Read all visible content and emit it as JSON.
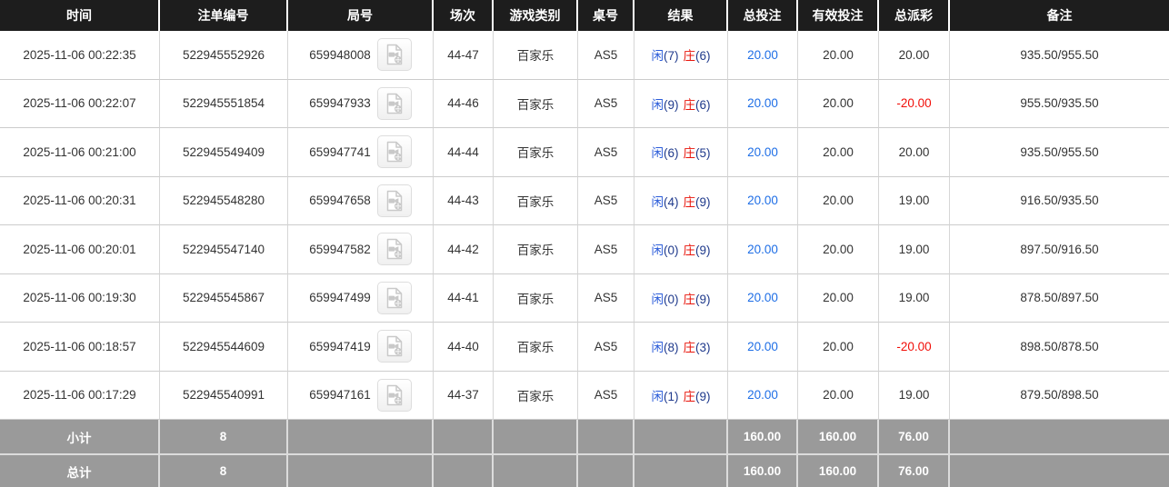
{
  "table": {
    "columns": [
      "时间",
      "注单编号",
      "局号",
      "场次",
      "游戏类别",
      "桌号",
      "结果",
      "总投注",
      "有效投注",
      "总派彩",
      "备注"
    ],
    "rows": [
      {
        "time": "2025-11-06 00:22:35",
        "bet_id": "522945552926",
        "round_id": "659948008",
        "session": "44-47",
        "game_type": "百家乐",
        "table_no": "AS5",
        "player": "闲",
        "player_score": "(7)",
        "banker": "庄",
        "banker_score": "(6)",
        "total_bet": "20.00",
        "valid_bet": "20.00",
        "payout": "20.00",
        "remark": "935.50/955.50"
      },
      {
        "time": "2025-11-06 00:22:07",
        "bet_id": "522945551854",
        "round_id": "659947933",
        "session": "44-46",
        "game_type": "百家乐",
        "table_no": "AS5",
        "player": "闲",
        "player_score": "(9)",
        "banker": "庄",
        "banker_score": "(6)",
        "total_bet": "20.00",
        "valid_bet": "20.00",
        "payout": "-20.00",
        "remark": "955.50/935.50"
      },
      {
        "time": "2025-11-06 00:21:00",
        "bet_id": "522945549409",
        "round_id": "659947741",
        "session": "44-44",
        "game_type": "百家乐",
        "table_no": "AS5",
        "player": "闲",
        "player_score": "(6)",
        "banker": "庄",
        "banker_score": "(5)",
        "total_bet": "20.00",
        "valid_bet": "20.00",
        "payout": "20.00",
        "remark": "935.50/955.50"
      },
      {
        "time": "2025-11-06 00:20:31",
        "bet_id": "522945548280",
        "round_id": "659947658",
        "session": "44-43",
        "game_type": "百家乐",
        "table_no": "AS5",
        "player": "闲",
        "player_score": "(4)",
        "banker": "庄",
        "banker_score": "(9)",
        "total_bet": "20.00",
        "valid_bet": "20.00",
        "payout": "19.00",
        "remark": "916.50/935.50"
      },
      {
        "time": "2025-11-06 00:20:01",
        "bet_id": "522945547140",
        "round_id": "659947582",
        "session": "44-42",
        "game_type": "百家乐",
        "table_no": "AS5",
        "player": "闲",
        "player_score": "(0)",
        "banker": "庄",
        "banker_score": "(9)",
        "total_bet": "20.00",
        "valid_bet": "20.00",
        "payout": "19.00",
        "remark": "897.50/916.50"
      },
      {
        "time": "2025-11-06 00:19:30",
        "bet_id": "522945545867",
        "round_id": "659947499",
        "session": "44-41",
        "game_type": "百家乐",
        "table_no": "AS5",
        "player": "闲",
        "player_score": "(0)",
        "banker": "庄",
        "banker_score": "(9)",
        "total_bet": "20.00",
        "valid_bet": "20.00",
        "payout": "19.00",
        "remark": "878.50/897.50"
      },
      {
        "time": "2025-11-06 00:18:57",
        "bet_id": "522945544609",
        "round_id": "659947419",
        "session": "44-40",
        "game_type": "百家乐",
        "table_no": "AS5",
        "player": "闲",
        "player_score": "(8)",
        "banker": "庄",
        "banker_score": "(3)",
        "total_bet": "20.00",
        "valid_bet": "20.00",
        "payout": "-20.00",
        "remark": "898.50/878.50"
      },
      {
        "time": "2025-11-06 00:17:29",
        "bet_id": "522945540991",
        "round_id": "659947161",
        "session": "44-37",
        "game_type": "百家乐",
        "table_no": "AS5",
        "player": "闲",
        "player_score": "(1)",
        "banker": "庄",
        "banker_score": "(9)",
        "total_bet": "20.00",
        "valid_bet": "20.00",
        "payout": "19.00",
        "remark": "879.50/898.50"
      }
    ],
    "footer": [
      {
        "label": "小计",
        "count": "8",
        "total_bet": "160.00",
        "valid_bet": "160.00",
        "payout": "76.00"
      },
      {
        "label": "总计",
        "count": "8",
        "total_bet": "160.00",
        "valid_bet": "160.00",
        "payout": "76.00"
      }
    ]
  },
  "icons": {
    "video_replay": "video-file-icon"
  },
  "colors": {
    "header_bg": "#1d1d1d",
    "header_text": "#ffffff",
    "footer_bg": "#9a9a9a",
    "bet_blue": "#1e6ee6",
    "player_blue": "#2b5cd9",
    "banker_red": "#e8150b",
    "score_navy": "#1f3a8c",
    "negative_red": "#f10e08",
    "body_text": "#333333"
  }
}
